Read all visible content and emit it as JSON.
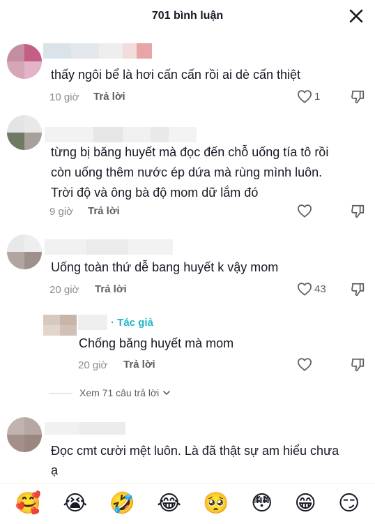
{
  "header": {
    "title": "701 bình luận"
  },
  "comments": [
    {
      "text_lines": [
        "thấy ngôi bể là hơi cấn cấn rồi ai dè cấn thiệt"
      ],
      "time": "10 giờ",
      "reply_label": "Trả lời",
      "likes": "1"
    },
    {
      "text_lines": [
        "từng bị băng huyết mà đọc đến chỗ uống tía tô rồi",
        "còn uống thêm nước ép dứa mà rùng mình luôn.",
        "Trời độ và ông bà độ mom dữ lắm đó"
      ],
      "time": "9 giờ",
      "reply_label": "Trả lời",
      "likes": ""
    },
    {
      "text_lines": [
        "Uống toàn thứ dễ bang huyết k vậy mom"
      ],
      "time": "20 giờ",
      "reply_label": "Trả lời",
      "likes": "43"
    },
    {
      "text_lines": [
        "Đọc cmt cười mệt luôn. Là đã thật sự am hiểu chưa",
        "ạ"
      ]
    }
  ],
  "reply": {
    "author_tag": "· Tác giả",
    "text": "Chống băng huyết mà mom",
    "time": "20 giờ",
    "reply_label": "Trả lời",
    "likes": ""
  },
  "view_more": "Xem 71 câu trả lời",
  "emojis": [
    "🥰",
    "😭",
    "🤣",
    "😂",
    "🥺",
    "😳",
    "😁",
    "😏"
  ],
  "icons": {
    "close": "close-icon",
    "like": "heart-outline-icon",
    "dislike": "thumbs-down-icon"
  }
}
